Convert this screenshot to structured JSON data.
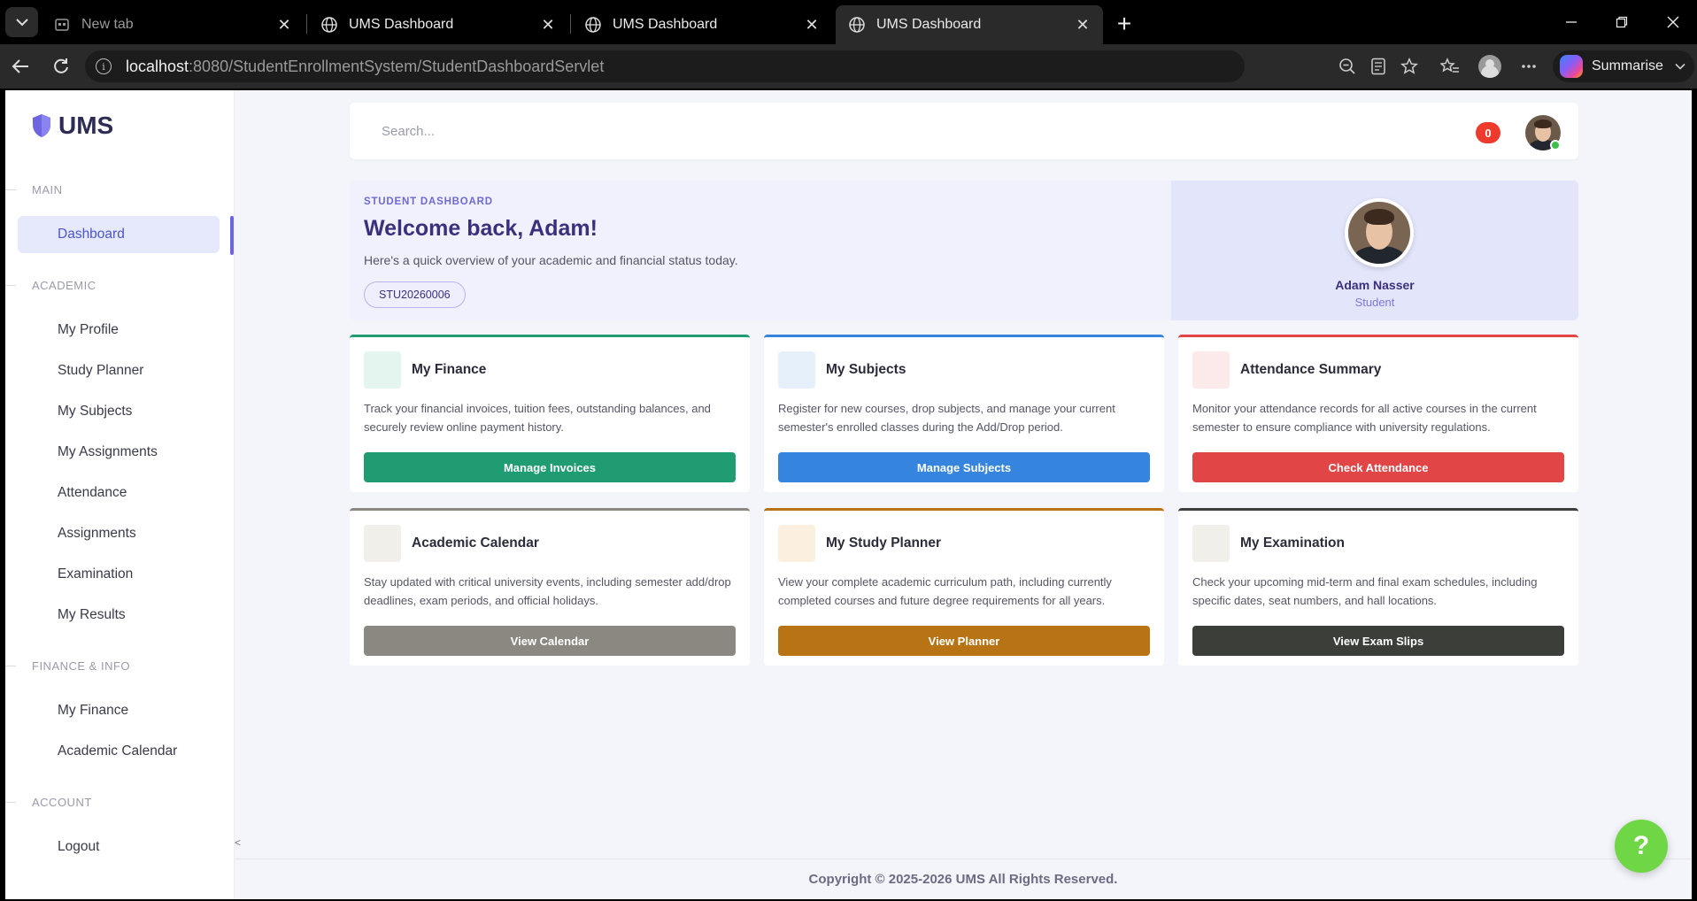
{
  "browser": {
    "tabs": [
      {
        "title": "New tab",
        "dim": true
      },
      {
        "title": "UMS Dashboard"
      },
      {
        "title": "UMS Dashboard"
      },
      {
        "title": "UMS Dashboard",
        "active": true
      }
    ],
    "url_host": "localhost",
    "url_rest": ":8080/StudentEnrollmentSystem/StudentDashboardServlet",
    "summarise_label": "Summarise"
  },
  "sidebar": {
    "brand": "UMS",
    "sections": {
      "main": "MAIN",
      "academic": "ACADEMIC",
      "finance": "FINANCE & INFO",
      "account": "ACCOUNT"
    },
    "items": {
      "dashboard": "Dashboard",
      "my_profile": "My Profile",
      "study_planner": "Study Planner",
      "my_subjects": "My Subjects",
      "my_assignments": "My Assignments",
      "attendance": "Attendance",
      "assignments": "Assignments",
      "examination": "Examination",
      "my_results": "My Results",
      "my_finance": "My Finance",
      "academic_calendar": "Academic Calendar",
      "logout": "Logout"
    },
    "collapse_glyph": "<"
  },
  "header": {
    "search_placeholder": "Search...",
    "notification_count": "0"
  },
  "hero": {
    "kicker": "STUDENT DASHBOARD",
    "title": "Welcome back, Adam!",
    "subtitle": "Here's a quick overview of your academic and financial status today.",
    "student_id": "STU20260006",
    "name": "Adam Nasser",
    "role": "Student"
  },
  "cards": [
    {
      "title": "My Finance",
      "desc": "Track your financial invoices, tuition fees, outstanding balances, and securely review online payment history.",
      "button": "Manage Invoices",
      "color": "#1f9c72",
      "tint": "#e3f5ee"
    },
    {
      "title": "My Subjects",
      "desc": "Register for new courses, drop subjects, and manage your current semester's enrolled classes during the Add/Drop period.",
      "button": "Manage Subjects",
      "color": "#3585df",
      "tint": "#e6f0fb"
    },
    {
      "title": "Attendance Summary",
      "desc": "Monitor your attendance records for all active courses in the current semester to ensure compliance with university regulations.",
      "button": "Check Attendance",
      "color": "#e24545",
      "tint": "#fce9e9"
    },
    {
      "title": "Academic Calendar",
      "desc": "Stay updated with critical university events, including semester add/drop deadlines, exam periods, and official holidays.",
      "button": "View Calendar",
      "color": "#8a8880",
      "tint": "#f1efea"
    },
    {
      "title": "My Study Planner",
      "desc": "View your complete academic curriculum path, including currently completed courses and future degree requirements for all years.",
      "button": "View Planner",
      "color": "#b87414",
      "tint": "#fbefdf"
    },
    {
      "title": "My Examination",
      "desc": "Check your upcoming mid-term and final exam schedules, including specific dates, seat numbers, and hall locations.",
      "button": "View Exam Slips",
      "color": "#3c3e3a",
      "tint": "#f1efea"
    }
  ],
  "footer": {
    "copyright": "Copyright © 2025-2026 UMS All Rights Reserved."
  },
  "help": {
    "glyph": "?"
  }
}
